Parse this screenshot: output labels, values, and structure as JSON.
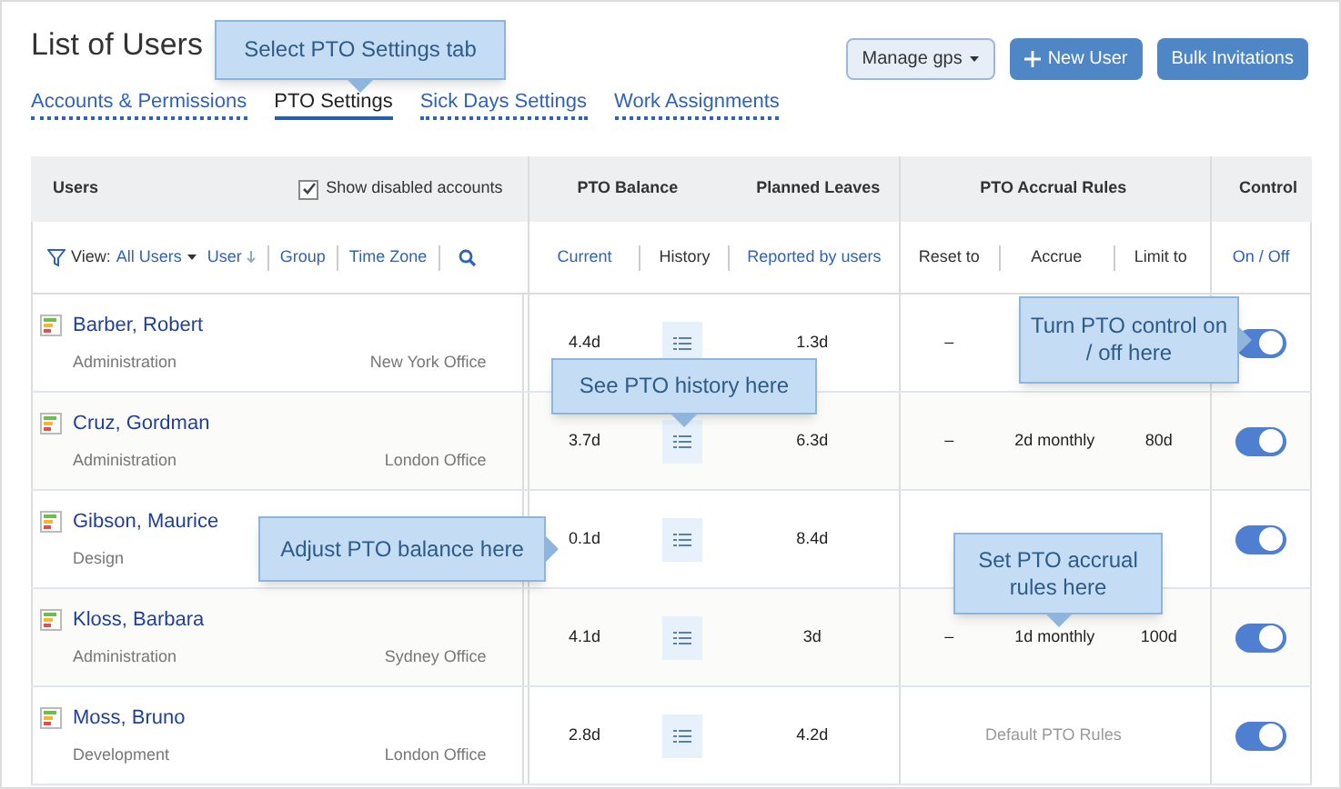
{
  "title": "List of Users",
  "actions": {
    "manage": "Manage gps",
    "new_user": "New User",
    "bulk": "Bulk Invitations"
  },
  "tabs": [
    {
      "label": "Accounts & Permissions",
      "selected": false
    },
    {
      "label": "PTO Settings",
      "selected": true
    },
    {
      "label": "Sick Days Settings",
      "selected": false
    },
    {
      "label": "Work Assignments",
      "selected": false
    }
  ],
  "headers": {
    "users": "Users",
    "show_disabled": {
      "label": "Show disabled accounts",
      "checked": true
    },
    "balance": "PTO Balance",
    "planned": "Planned Leaves",
    "rules": "PTO Accrual Rules",
    "control": "Control"
  },
  "filters": {
    "view_label": "View:",
    "view_value": "All Users",
    "columns": [
      "User",
      "Group",
      "Time Zone"
    ]
  },
  "subheaders": {
    "current": "Current",
    "history": "History",
    "reported": "Reported by users",
    "reset": "Reset to",
    "accrue": "Accrue",
    "limit": "Limit to",
    "onoff": "On / Off"
  },
  "rows": [
    {
      "name": "Barber, Robert",
      "group": "Administration",
      "office": "New York Office",
      "balance": "4.4d",
      "planned": "1.3d",
      "rules": {
        "kind": "custom",
        "reset": "–"
      },
      "on": true
    },
    {
      "name": "Cruz, Gordman",
      "group": "Administration",
      "office": "London Office",
      "balance": "3.7d",
      "planned": "6.3d",
      "rules": {
        "kind": "custom",
        "reset": "–",
        "accrue": "2d monthly",
        "limit": "80d"
      },
      "on": true
    },
    {
      "name": "Gibson, Maurice",
      "group": "Design",
      "balance": "0.1d",
      "planned": "8.4d",
      "rules": {
        "kind": "hidden"
      },
      "on": true
    },
    {
      "name": "Kloss, Barbara",
      "group": "Administration",
      "office": "Sydney Office",
      "balance": "4.1d",
      "planned": "3d",
      "rules": {
        "kind": "custom",
        "reset": "–",
        "accrue": "1d monthly",
        "limit": "100d"
      },
      "on": true
    },
    {
      "name": "Moss, Bruno",
      "group": "Development",
      "office": "London Office",
      "balance": "2.8d",
      "planned": "4.2d",
      "rules": {
        "kind": "default",
        "text": "Default PTO Rules"
      },
      "on": true
    }
  ],
  "callouts": [
    {
      "text": "Select PTO Settings tab",
      "kind": "down"
    },
    {
      "text": "See PTO history here",
      "kind": "down"
    },
    {
      "text": "Adjust PTO balance here",
      "kind": "right"
    },
    {
      "text": "Turn PTO control on / off here",
      "kind": "right"
    },
    {
      "text": "Set PTO accrual rules here",
      "kind": "down"
    }
  ]
}
